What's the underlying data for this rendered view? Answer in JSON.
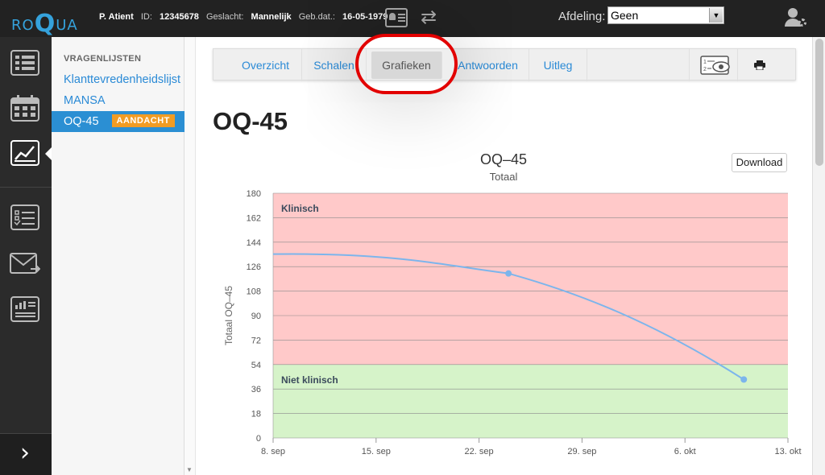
{
  "header": {
    "logo": {
      "prefix": "RO",
      "big": "Q",
      "suffix": "UA"
    },
    "patient": {
      "name": "P. Atient",
      "id_label": "ID:",
      "id_value": "12345678",
      "gender_label": "Geslacht:",
      "gender_value": "Mannelijk",
      "dob_label": "Geb.dat.:",
      "dob_value": "16-05-1979"
    },
    "afdeling_label": "Afdeling:",
    "afdeling_value": "Geen"
  },
  "leftnav": {
    "items": [
      {
        "name": "list",
        "icon": "list-icon"
      },
      {
        "name": "calendar",
        "icon": "calendar-icon"
      },
      {
        "name": "chart",
        "icon": "chart-icon",
        "active": true
      },
      {
        "name": "checklist",
        "icon": "checklist-icon"
      },
      {
        "name": "mail",
        "icon": "mail-icon"
      },
      {
        "name": "report",
        "icon": "report-icon"
      }
    ],
    "expand_glyph": "›"
  },
  "sidebar": {
    "heading": "VRAGENLIJSTEN",
    "items": [
      {
        "label": "Klanttevredenheidslijst"
      },
      {
        "label": "MANSA"
      },
      {
        "label": "OQ-45",
        "badge": "AANDACHT",
        "active": true
      }
    ]
  },
  "tabs": {
    "items": [
      "Overzicht",
      "Schalen",
      "Grafieken",
      "Antwoorden",
      "Uitleg"
    ],
    "active": "Grafieken"
  },
  "page_title": "OQ-45",
  "download_label": "Download",
  "chart_data": {
    "type": "line",
    "title": "OQ–45",
    "subtitle": "Totaal",
    "ylabel": "Totaal OQ–45",
    "xlabel": "",
    "ylim": [
      0,
      180
    ],
    "yticks": [
      0,
      18,
      36,
      54,
      72,
      90,
      108,
      126,
      144,
      162,
      180
    ],
    "xticks": [
      "8. sep",
      "15. sep",
      "22. sep",
      "29. sep",
      "6. okt",
      "13. okt"
    ],
    "bands": [
      {
        "label": "Klinisch",
        "from": 54,
        "to": 180,
        "color": "#ffc9c9"
      },
      {
        "label": "Niet klinisch",
        "from": 0,
        "to": 54,
        "color": "#d6f3c9"
      }
    ],
    "series": [
      {
        "color": "#7cb5ec",
        "points": [
          {
            "x": "24. sep",
            "y": 121
          },
          {
            "x": "10. okt",
            "y": 43
          }
        ]
      }
    ]
  }
}
